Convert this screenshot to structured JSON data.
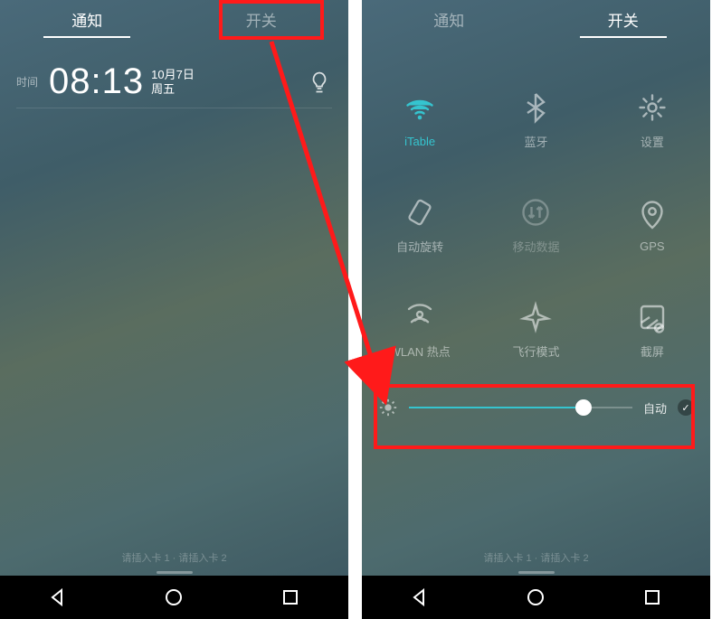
{
  "left": {
    "tabs": {
      "notifications": "通知",
      "toggles": "开关"
    },
    "time_label": "时间",
    "time": "08:13",
    "date": "10月7日",
    "weekday": "周五",
    "sim_hint": "请插入卡 1 · 请插入卡 2"
  },
  "right": {
    "tabs": {
      "notifications": "通知",
      "toggles": "开关"
    },
    "tiles": [
      {
        "id": "wifi",
        "label": "iTable",
        "active": true
      },
      {
        "id": "bt",
        "label": "蓝牙",
        "active": false
      },
      {
        "id": "settings",
        "label": "设置",
        "active": false
      },
      {
        "id": "rotate",
        "label": "自动旋转",
        "active": false
      },
      {
        "id": "data",
        "label": "移动数据",
        "active": false,
        "dim": true
      },
      {
        "id": "gps",
        "label": "GPS",
        "active": false
      },
      {
        "id": "hotspot",
        "label": "WLAN 热点",
        "active": false
      },
      {
        "id": "airplane",
        "label": "飞行模式",
        "active": false
      },
      {
        "id": "shot",
        "label": "截屏",
        "active": false
      }
    ],
    "brightness": {
      "auto_label": "自动",
      "value_pct": 78,
      "auto_checked": true
    },
    "sim_hint": "请插入卡 1 · 请插入卡 2"
  }
}
